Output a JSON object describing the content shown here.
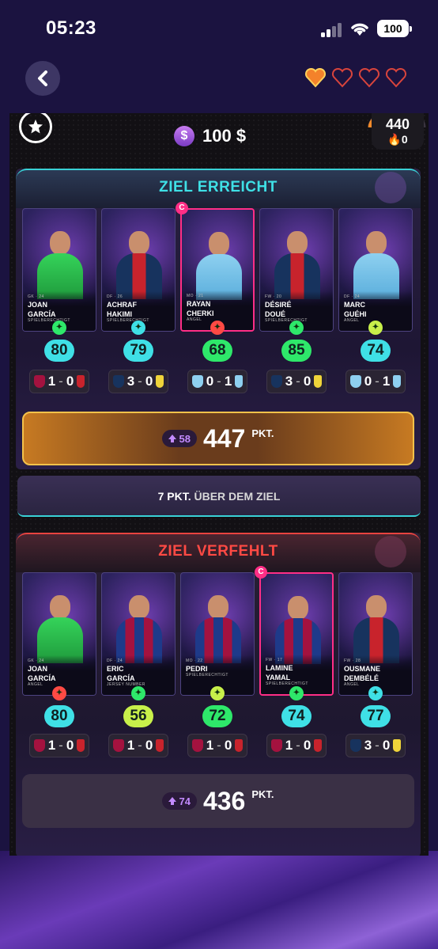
{
  "status": {
    "time": "05:23",
    "battery": "100"
  },
  "colors": {
    "gold": "#f4c24a",
    "teal": "#3fe0e6",
    "red": "#ff4a44",
    "green_pts": "#2ee86a",
    "cyan_pts": "#3fe0e6",
    "lime_pts": "#c8f04a"
  },
  "topbar": {
    "back_icon": "chevron-left-icon",
    "hearts": [
      {
        "state": "full"
      },
      {
        "state": "empty"
      },
      {
        "state": "empty"
      },
      {
        "state": "empty"
      }
    ]
  },
  "header": {
    "money": "100 $",
    "coin_symbol": "$",
    "score": "440",
    "fire": "0"
  },
  "section1": {
    "title": "ZIEL ERREICHT",
    "players": [
      {
        "first": "JOAN",
        "last": "GARCÍA",
        "pos": "GK",
        "age": "24",
        "label": "SPIELBERECHTIGT",
        "points": "80",
        "home": "1",
        "away": "0",
        "kit": "green",
        "captain": false
      },
      {
        "first": "ACHRAF",
        "last": "HAKIMI",
        "pos": "DF",
        "age": "26",
        "label": "SPIELBERECHTIGT",
        "points": "79",
        "home": "3",
        "away": "0",
        "kit": "psg",
        "captain": false
      },
      {
        "first": "RAYAN",
        "last": "CHERKI",
        "pos": "MO",
        "age": "21",
        "label": "ANGEL",
        "points": "68",
        "home": "0",
        "away": "1",
        "kit": "city",
        "captain": true
      },
      {
        "first": "DÉSIRÉ",
        "last": "DOUÉ",
        "pos": "FW",
        "age": "20",
        "label": "SPIELBERECHTIGT",
        "points": "85",
        "home": "3",
        "away": "0",
        "kit": "psg",
        "captain": false
      },
      {
        "first": "MARC",
        "last": "GUÉHI",
        "pos": "DF",
        "age": "24",
        "label": "ANGEL",
        "points": "74",
        "home": "0",
        "away": "1",
        "kit": "city",
        "captain": false
      }
    ],
    "delta": "58",
    "total": "447",
    "unit": "PKT.",
    "above_strong": "7 PKT.",
    "above_rest": "ÜBER DEM ZIEL"
  },
  "section2": {
    "title": "ZIEL VERFEHLT",
    "players": [
      {
        "first": "JOAN",
        "last": "GARCÍA",
        "pos": "GK",
        "age": "24",
        "label": "ANGEL",
        "points": "80",
        "home": "1",
        "away": "0",
        "kit": "green",
        "captain": false
      },
      {
        "first": "ERIC",
        "last": "GARCÍA",
        "pos": "DF",
        "age": "24",
        "label": "JERSEY NUMBER",
        "points": "56",
        "home": "1",
        "away": "0",
        "kit": "barca",
        "captain": false
      },
      {
        "first": "",
        "last": "PEDRI",
        "pos": "MO",
        "age": "22",
        "label": "SPIELBERECHTIGT",
        "points": "72",
        "home": "1",
        "away": "0",
        "kit": "barca",
        "captain": false
      },
      {
        "first": "LAMINE",
        "last": "YAMAL",
        "pos": "FW",
        "age": "17",
        "label": "SPIELBERECHTIGT",
        "points": "74",
        "home": "1",
        "away": "0",
        "kit": "barca",
        "captain": true
      },
      {
        "first": "OUSMANE",
        "last": "DEMBÉLÉ",
        "pos": "FW",
        "age": "28",
        "label": "ANGEL",
        "points": "77",
        "home": "3",
        "away": "0",
        "kit": "psg",
        "captain": false
      }
    ],
    "delta": "74",
    "total": "436",
    "unit": "PKT."
  },
  "card_text": {
    "captain": "C",
    "jersey": "#24"
  }
}
